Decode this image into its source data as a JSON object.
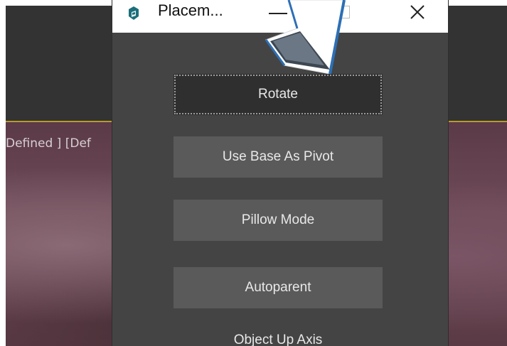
{
  "window": {
    "title": "Placem...",
    "icon": "app-3d-icon"
  },
  "viewport": {
    "label": "Defined ] [Def",
    "border_color": "#b79b2a"
  },
  "menu": {
    "items": [
      {
        "label": "Rotate",
        "active": true
      },
      {
        "label": "Use Base As Pivot",
        "active": false
      },
      {
        "label": "Pillow Mode",
        "active": false
      },
      {
        "label": "Autoparent",
        "active": false
      },
      {
        "label": "Object Up Axis",
        "active": false
      }
    ]
  },
  "colors": {
    "popup_bg": "#444444",
    "button_bg": "#5a5a5a",
    "active_button_bg": "#2f2f2f",
    "button_text": "#e8e8e8"
  }
}
